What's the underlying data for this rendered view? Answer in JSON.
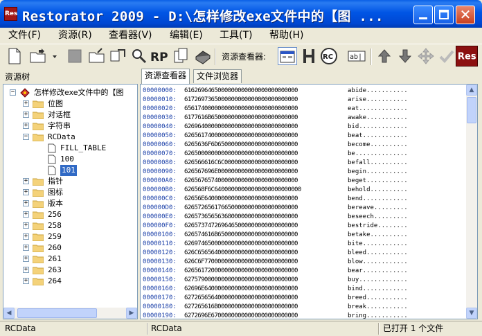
{
  "window": {
    "icon_text": "Res",
    "title": "Restorator 2009 - D:\\怎样修改exe文件中的【图 ...",
    "close_glyph": "✕"
  },
  "menu": [
    {
      "label": "文件(F)"
    },
    {
      "label": "资源(R)"
    },
    {
      "label": "查看器(V)"
    },
    {
      "label": "编辑(E)"
    },
    {
      "label": "工具(T)"
    },
    {
      "label": "帮助(H)"
    }
  ],
  "toolbar": {
    "viewer_label": "资源查看器:",
    "rp_label": "RP",
    "rc_label": "RC",
    "abi_label": "ab|",
    "res_logo": "Res",
    "buttons": [
      {
        "icon": "new-file-icon"
      },
      {
        "icon": "open-folder-icon"
      },
      {
        "icon": "dropdown-arrow-icon"
      },
      {
        "icon": "disabled-square-icon"
      },
      {
        "icon": "export-icon"
      },
      {
        "icon": "grab-icon"
      },
      {
        "icon": "search-icon"
      },
      {
        "icon": "rp-icon"
      },
      {
        "icon": "copy-pages-icon"
      },
      {
        "icon": "book-icon"
      },
      {
        "icon": "dialog-viewer-icon"
      },
      {
        "icon": "hex-viewer-icon"
      },
      {
        "icon": "rc-icon"
      },
      {
        "icon": "text-field-icon"
      },
      {
        "icon": "arrow-up-icon"
      },
      {
        "icon": "arrow-down-icon"
      },
      {
        "icon": "move-icon"
      },
      {
        "icon": "check-icon"
      },
      {
        "icon": "res-logo-icon"
      }
    ]
  },
  "tree": {
    "label": "资源树",
    "root": "怎样修改exe文件中的【图",
    "expand_glyph": "+",
    "collapse_glyph": "−",
    "items": [
      {
        "label": "位图",
        "level": 1,
        "expander": "+"
      },
      {
        "label": "对话框",
        "level": 1,
        "expander": "+"
      },
      {
        "label": "字符串",
        "level": 1,
        "expander": "+"
      },
      {
        "label": "RCData",
        "level": 1,
        "expander": "−",
        "mono": true
      },
      {
        "label": "FILL_TABLE",
        "level": 2,
        "expander": "",
        "mono": true
      },
      {
        "label": "100",
        "level": 2,
        "expander": "",
        "mono": true
      },
      {
        "label": "101",
        "level": 2,
        "expander": "",
        "mono": true,
        "selected": true
      },
      {
        "label": "指针",
        "level": 1,
        "expander": "+"
      },
      {
        "label": "图标",
        "level": 1,
        "expander": "+"
      },
      {
        "label": "版本",
        "level": 1,
        "expander": "+"
      },
      {
        "label": "256",
        "level": 1,
        "expander": "+",
        "mono": true
      },
      {
        "label": "258",
        "level": 1,
        "expander": "+",
        "mono": true
      },
      {
        "label": "259",
        "level": 1,
        "expander": "+",
        "mono": true
      },
      {
        "label": "260",
        "level": 1,
        "expander": "+",
        "mono": true
      },
      {
        "label": "261",
        "level": 1,
        "expander": "+",
        "mono": true
      },
      {
        "label": "263",
        "level": 1,
        "expander": "+",
        "mono": true
      },
      {
        "label": "264",
        "level": 1,
        "expander": "+",
        "mono": true
      }
    ]
  },
  "tabs": [
    {
      "label": "资源查看器",
      "active": true
    },
    {
      "label": "文件浏览器",
      "active": false
    }
  ],
  "hex": {
    "rows": [
      {
        "offset": "00000000:",
        "bytes": "6162696465000000000000000000000000",
        "ascii": "abide..........."
      },
      {
        "offset": "00000010:",
        "bytes": "6172697365000000000000000000000000",
        "ascii": "arise..........."
      },
      {
        "offset": "00000020:",
        "bytes": "6561740000000000000000000000000000",
        "ascii": "eat............."
      },
      {
        "offset": "00000030:",
        "bytes": "6177616B65000000000000000000000000",
        "ascii": "awake..........."
      },
      {
        "offset": "00000040:",
        "bytes": "6269640000000000000000000000000000",
        "ascii": "bid............."
      },
      {
        "offset": "00000050:",
        "bytes": "6265617400000000000000000000000000",
        "ascii": "beat............"
      },
      {
        "offset": "00000060:",
        "bytes": "6265636F6D650000000000000000000000",
        "ascii": "become.........."
      },
      {
        "offset": "00000070:",
        "bytes": "6265000000000000000000000000000000",
        "ascii": "be.............."
      },
      {
        "offset": "00000080:",
        "bytes": "626566616C6C0000000000000000000000",
        "ascii": "befall.........."
      },
      {
        "offset": "00000090:",
        "bytes": "626567696E000000000000000000000000",
        "ascii": "begin..........."
      },
      {
        "offset": "000000A0:",
        "bytes": "6265676574000000000000000000000000",
        "ascii": "beget..........."
      },
      {
        "offset": "000000B0:",
        "bytes": "626568F6C64000000000000000000000000",
        "ascii": "behold.........."
      },
      {
        "offset": "000000C0:",
        "bytes": "62656E6400000000000000000000000000",
        "ascii": "bend............"
      },
      {
        "offset": "000000D0:",
        "bytes": "6265726561766500000000000000000000",
        "ascii": "bereave........."
      },
      {
        "offset": "000000E0:",
        "bytes": "6265736565636800000000000000000000",
        "ascii": "beseech........."
      },
      {
        "offset": "000000F0:",
        "bytes": "6265737472696465000000000000000000",
        "ascii": "bestride........"
      },
      {
        "offset": "00000100:",
        "bytes": "626574616B650000000000000000000000",
        "ascii": "betake.........."
      },
      {
        "offset": "00000110:",
        "bytes": "6269746500000000000000000000000000",
        "ascii": "bite............"
      },
      {
        "offset": "00000120:",
        "bytes": "626C656564000000000000000000000000",
        "ascii": "bleed..........."
      },
      {
        "offset": "00000130:",
        "bytes": "626C6F7700000000000000000000000000",
        "ascii": "blow............"
      },
      {
        "offset": "00000140:",
        "bytes": "6265617200000000000000000000000000",
        "ascii": "bear............"
      },
      {
        "offset": "00000150:",
        "bytes": "6275790000000000000000000000000000",
        "ascii": "buy............."
      },
      {
        "offset": "00000160:",
        "bytes": "62696E6400000000000000000000000000",
        "ascii": "bind............"
      },
      {
        "offset": "00000170:",
        "bytes": "6272656564000000000000000000000000",
        "ascii": "breed..........."
      },
      {
        "offset": "00000180:",
        "bytes": "627265616B000000000000000000000000",
        "ascii": "break..........."
      },
      {
        "offset": "00000190:",
        "bytes": "6272696E67000000000000000000000000",
        "ascii": "bring..........."
      }
    ]
  },
  "status": {
    "left": "RCData",
    "middle": "RCData",
    "right": "已打开  1 个文件"
  },
  "colors": {
    "titlebar": "#0055e5",
    "selected": "#316ac5",
    "offset_text": "#1a3fa8"
  }
}
